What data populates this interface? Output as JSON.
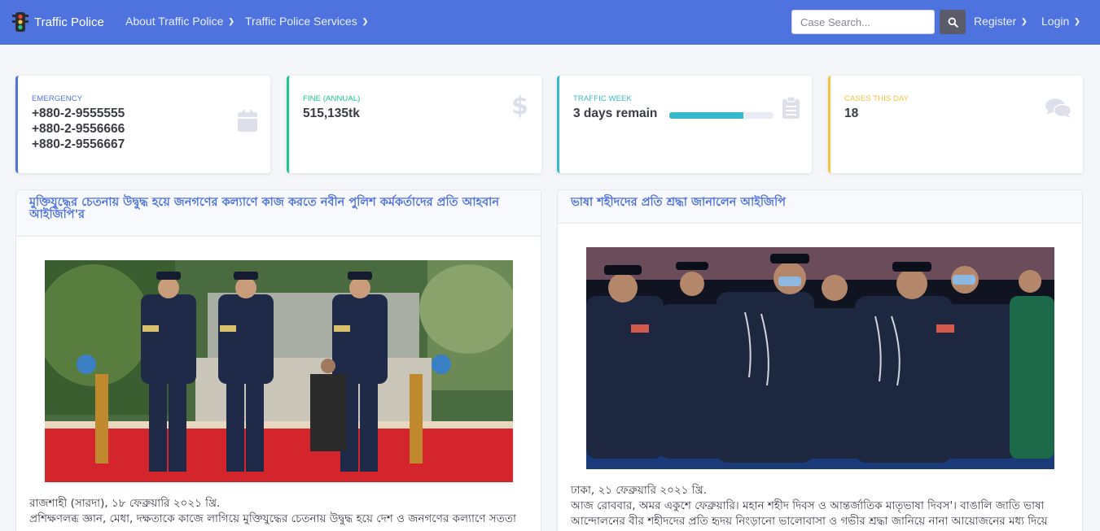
{
  "navbar": {
    "brand": "Traffic Police",
    "links": [
      {
        "label": "About Traffic Police"
      },
      {
        "label": "Traffic Police Services"
      }
    ],
    "search": {
      "placeholder": "Case Search..."
    },
    "right_links": [
      {
        "label": "Register"
      },
      {
        "label": "Login"
      }
    ]
  },
  "stats": {
    "emergency": {
      "label": "EMERGENCY",
      "phones": [
        "+880-2-9555555",
        "+880-2-9556666",
        "+880-2-9556667"
      ],
      "icon": "calendar-icon",
      "color": "#4e73df"
    },
    "fine": {
      "label": "FINE (ANNUAL)",
      "value": "515,135tk",
      "icon": "dollar-icon",
      "color": "#1cc88a"
    },
    "traffic_week": {
      "label": "TRAFFIC WEEK",
      "value": "3 days remain",
      "progress": 0.71,
      "icon": "clipboard-icon",
      "color": "#36b9cc"
    },
    "cases": {
      "label": "CASES THIS DAY",
      "value": "18",
      "icon": "comments-icon",
      "color": "#f6c23e"
    }
  },
  "news": [
    {
      "title": "মুক্তিযুদ্ধের চেতনায় উদ্বুদ্ধ হয়ে জনগণের কল্যাণে কাজ করতে নবীন পুলিশ কর্মকর্তাদের প্রতি আহবান আইজিপি'র",
      "dateline": "রাজশাহী (সারদা), ১৮ ফেব্রুয়ারি ২০২১ খ্রি.",
      "body": "প্রশিক্ষণলব্ধ জ্ঞান, মেধা, দক্ষতাকে কাজে লাগিয়ে মুক্তিযুদ্ধের চেতনায় উদ্বুদ্ধ হয়ে দেশ ও জনগণের কল্যাণে সততা"
    },
    {
      "title": "ভাষা শহীদদের প্রতি শ্রদ্ধা জানালেন আইজিপি",
      "dateline": "ঢাকা, ২১ ফেব্রুয়ারি ২০২১ খ্রি.",
      "body": "আজ রোববার, অমর একুশে ফেব্রুয়ারি। মহান শহীদ দিবস ও আন্তর্জাতিক মাতৃভাষা দিবস'। বাঙালি জাতি ভাষা আন্দোলনের বীর শহীদদের প্রতি হৃদয় নিংড়ানো ভালোবাসা ও গভীর শ্রদ্ধা জানিয়ে নানা আয়োজনের মধ্য দিয়ে"
    }
  ]
}
